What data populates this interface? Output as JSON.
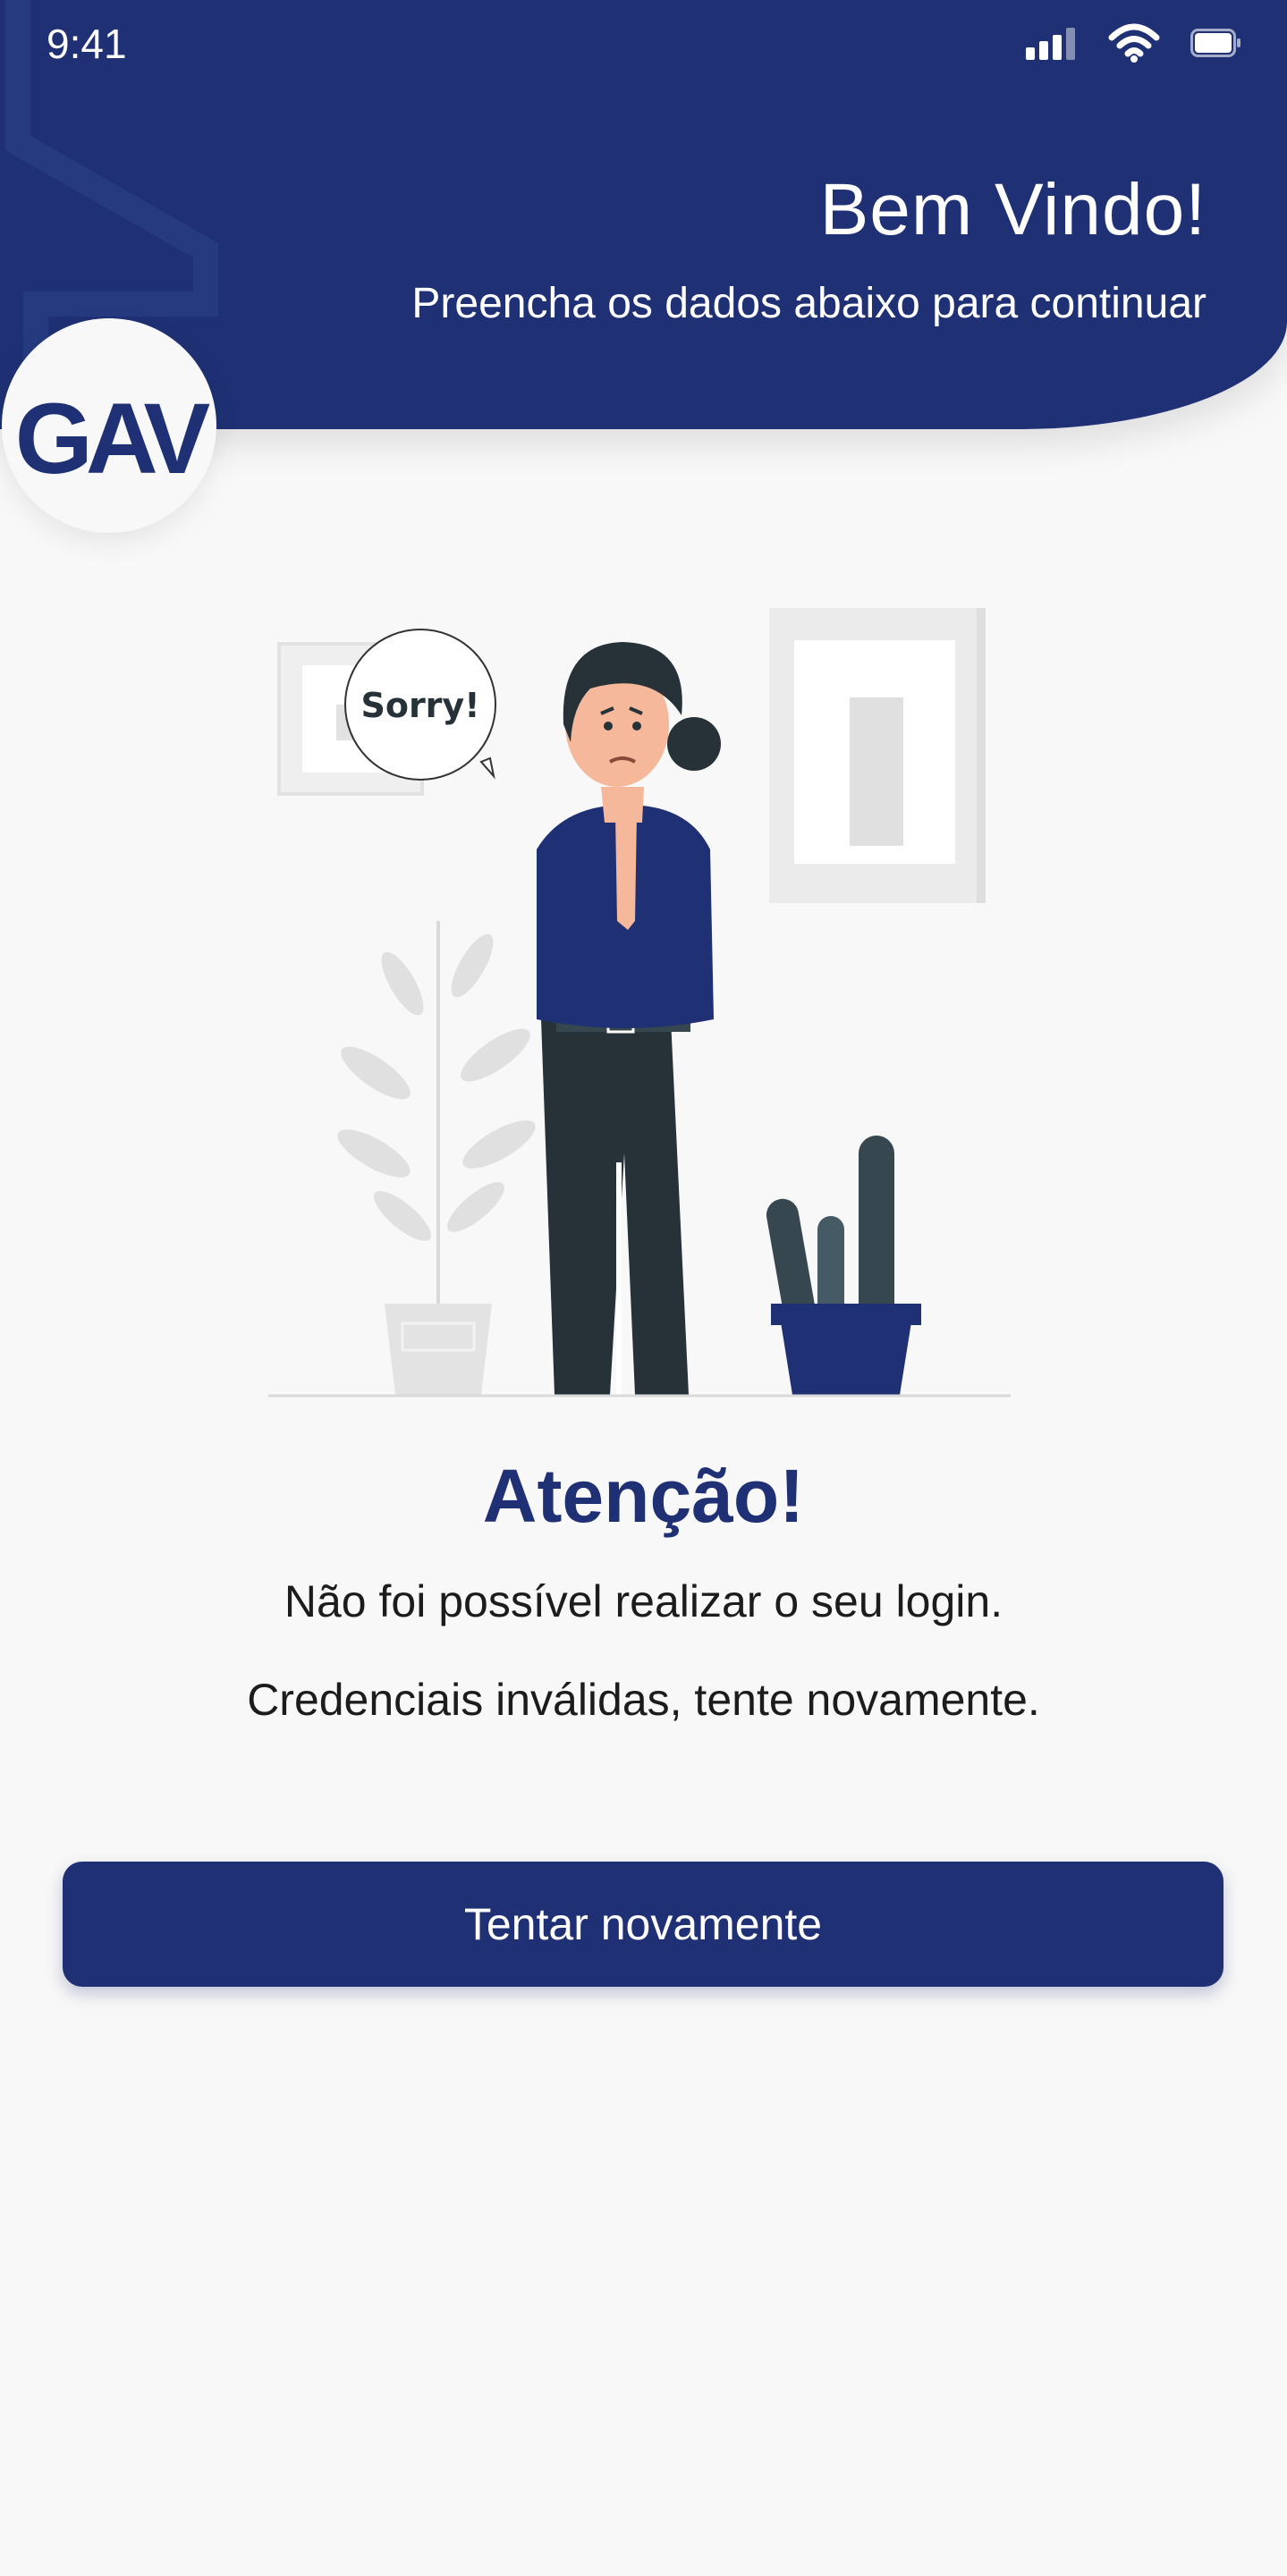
{
  "status_bar": {
    "time": "9:41",
    "icons": [
      "signal-icon",
      "wifi-icon",
      "battery-icon"
    ]
  },
  "header": {
    "title": "Bem Vindo!",
    "subtitle": "Preencha os dados abaixo para continuar",
    "logo_text": "GAV"
  },
  "illustration": {
    "speech_bubble": "Sorry!"
  },
  "message": {
    "title": "Atenção!",
    "line1": "Não foi possível realizar o seu login.",
    "line2": "Credenciais inválidas, tente novamente."
  },
  "actions": {
    "retry_label": "Tentar novamente"
  },
  "colors": {
    "primary": "#1f3174",
    "background": "#f8f8f8",
    "text": "#1c1c1c"
  }
}
